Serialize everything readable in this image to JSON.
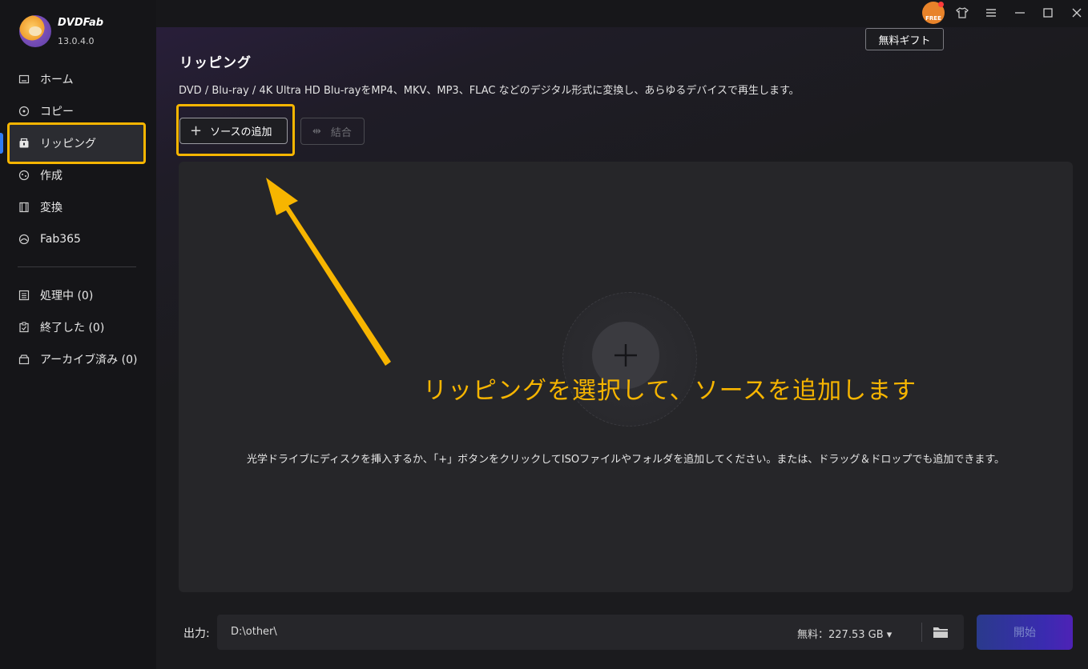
{
  "app": {
    "brand": "DVDFab",
    "version": "13.0.4.0"
  },
  "sidebar": {
    "items": [
      {
        "label": "ホーム",
        "icon": "home-icon"
      },
      {
        "label": "コピー",
        "icon": "copy-icon"
      },
      {
        "label": "リッピング",
        "icon": "ripper-icon"
      },
      {
        "label": "作成",
        "icon": "creator-icon"
      },
      {
        "label": "変換",
        "icon": "film-icon"
      },
      {
        "label": "Fab365",
        "icon": "fab365-icon"
      }
    ],
    "queue": [
      {
        "label": "処理中 (0)",
        "icon": "list-icon"
      },
      {
        "label": "終了した (0)",
        "icon": "clipboard-icon"
      },
      {
        "label": "アーカイブ済み (0)",
        "icon": "archive-icon"
      }
    ]
  },
  "titlebar": {
    "free_badge": "FREE",
    "gift_label": "無料ギフト"
  },
  "main": {
    "title": "リッピング",
    "description": "DVD / Blu-ray / 4K Ultra HD Blu-rayをMP4、MKV、MP3、FLAC などのデジタル形式に変換し、あらゆるデバイスで再生します。",
    "add_source_label": "ソースの追加",
    "merge_label": "結合",
    "drop_hint": "光学ドライブにディスクを挿入するか、「+」ボタンをクリックしてISOファイルやフォルダを追加してください。または、ドラッグ＆ドロップでも追加できます。",
    "annotation": "リッピングを選択して、ソースを追加します"
  },
  "footer": {
    "output_label": "出力:",
    "output_path": "D:\\other\\",
    "free_space": "無料：227.53 GB ▾",
    "start_label": "開始"
  },
  "colors": {
    "highlight": "#f7b500",
    "accent": "#2f7bf5"
  }
}
